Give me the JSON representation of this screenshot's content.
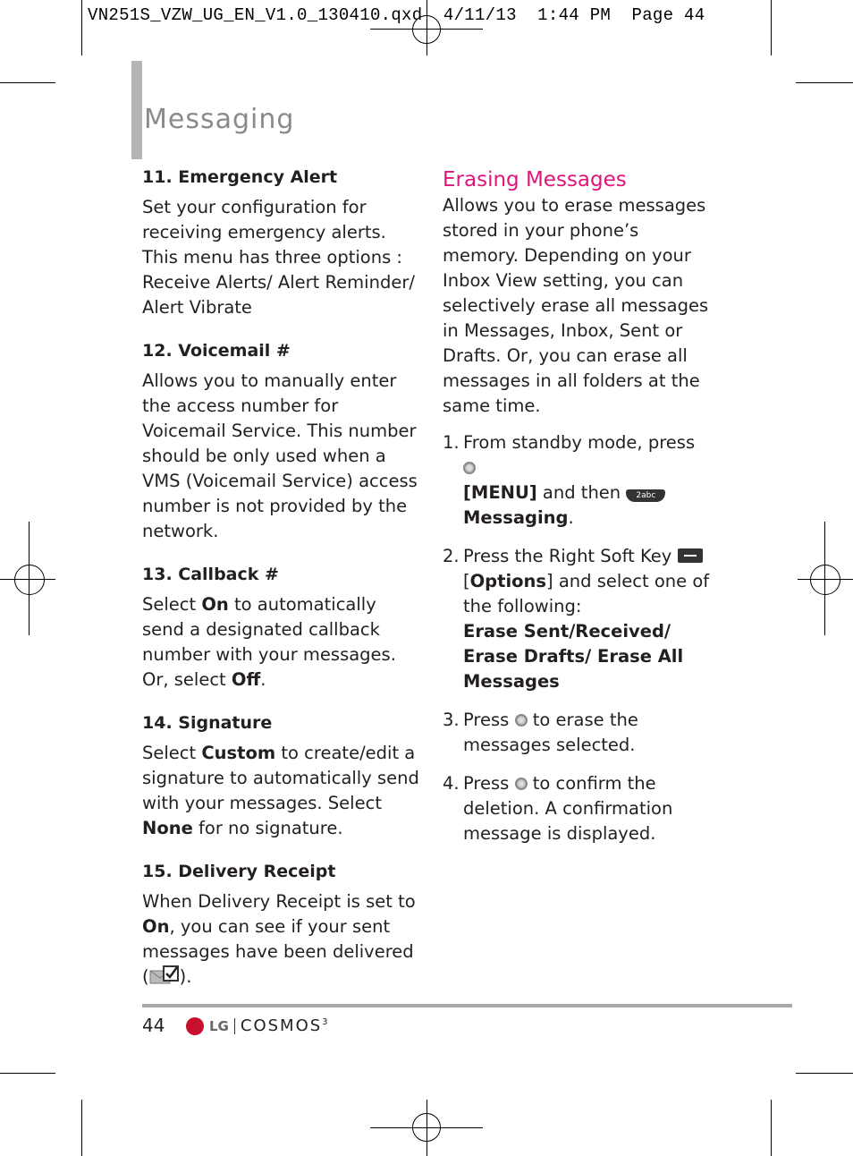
{
  "slug": "VN251S_VZW_UG_EN_V1.0_130410.qxd  4/11/13  1:44 PM  Page 44",
  "section_title": "Messaging",
  "left_column": [
    {
      "heading": "11. Emergency Alert",
      "body": "Set your configuration for receiving emergency alerts. This menu has three options : Receive Alerts/ Alert Reminder/ Alert Vibrate"
    },
    {
      "heading": "12. Voicemail #",
      "body": "Allows you to manually enter the access number for Voicemail Service. This number should be only used when a VMS (Voicemail Service) access number is not provided by the network."
    },
    {
      "heading": "13. Callback #",
      "body_pre": "Select ",
      "bold1": "On",
      "body_mid": " to automatically send a designated callback number with your messages. Or, select ",
      "bold2": "Off",
      "body_post": "."
    },
    {
      "heading": "14. Signature",
      "body_pre": "Select ",
      "bold1": "Custom",
      "body_mid": " to create/edit a signature to automatically send with your messages. Select ",
      "bold2": "None",
      "body_post": " for no signature."
    },
    {
      "heading": "15. Delivery Receipt",
      "body_pre": "When Delivery Receipt is set to ",
      "bold1": "On",
      "body_mid": ", you can see if your sent messages have been delivered (",
      "icon": "delivered-envelope-icon",
      "body_post": ")."
    }
  ],
  "right_column": {
    "heading": "Erasing Messages",
    "intro": "Allows you to erase messages stored in your phone’s memory. Depending on your Inbox View setting, you can selectively erase all messages in Messages, Inbox, Sent or Drafts. Or, you can erase all messages in all folders at the same time.",
    "steps": [
      {
        "num": "1.",
        "t1": "From standby mode, press ",
        "b1": "[MENU]",
        "t2": " and then ",
        "key_label": "2abc",
        "b2": "Messaging",
        "t3": "."
      },
      {
        "num": "2.",
        "t1": "Press the Right Soft Key ",
        "t2": "[",
        "b1": "Options",
        "t3": "] and select one of the following:",
        "b2": "Erase Sent/Received/ Erase Drafts/ Erase All Messages"
      },
      {
        "num": "3.",
        "t1": "Press ",
        "t2": " to erase the messages selected."
      },
      {
        "num": "4.",
        "t1": "Press ",
        "t2": " to confirm the deletion. A confirmation message is displayed."
      }
    ]
  },
  "footer": {
    "page_number": "44",
    "brand": "LG",
    "product": "COSMOS",
    "product_suffix": "3"
  }
}
